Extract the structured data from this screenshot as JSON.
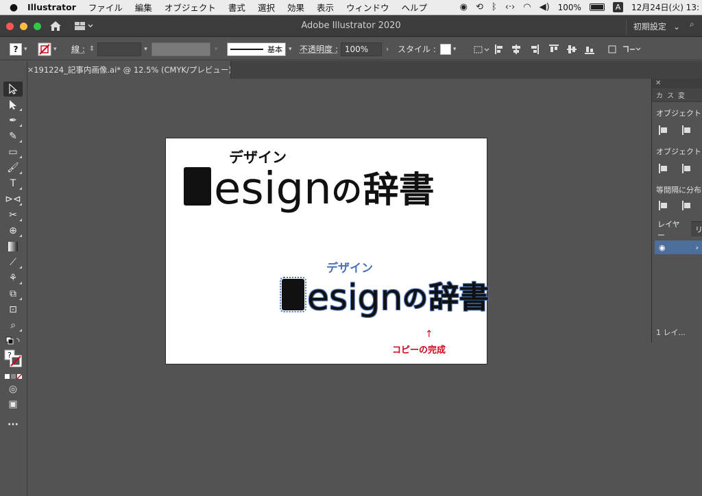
{
  "menubar": {
    "app": "Illustrator",
    "items": [
      "ファイル",
      "編集",
      "オブジェクト",
      "書式",
      "選択",
      "効果",
      "表示",
      "ウィンドウ",
      "ヘルプ"
    ],
    "battery_label": "100%",
    "ime": "A",
    "clock": "12月24日(火)  13:"
  },
  "titlebar": {
    "title": "Adobe Illustrator 2020",
    "workspace": "初期設定"
  },
  "controlbar": {
    "fill_label": "?",
    "stroke_label": "線 :",
    "stroke_style": "基本",
    "opacity_label": "不透明度 :",
    "opacity_value": "100%",
    "style_label": "スタイル :"
  },
  "document": {
    "tab_label": "191224_記事内画像.ai* @ 12.5% (CMYK/プレビュー)"
  },
  "artwork": {
    "subtitle": "デザイン",
    "word": "esign",
    "no": "の",
    "jp_title": "辞書",
    "annotation_arrow": "↑",
    "annotation": "コピーの完成"
  },
  "panel": {
    "tabs": [
      "カ",
      "ス",
      "変"
    ],
    "align_objects": "オブジェクト",
    "align_objects2": "オブジェクト",
    "distribute": "等間隔に分布",
    "layers_tab": "レイヤー",
    "layers_tab2": "リ",
    "layer_count": "1 レイ..."
  },
  "colors": {
    "selection": "#4a72b8",
    "annotation": "#d0021b"
  }
}
